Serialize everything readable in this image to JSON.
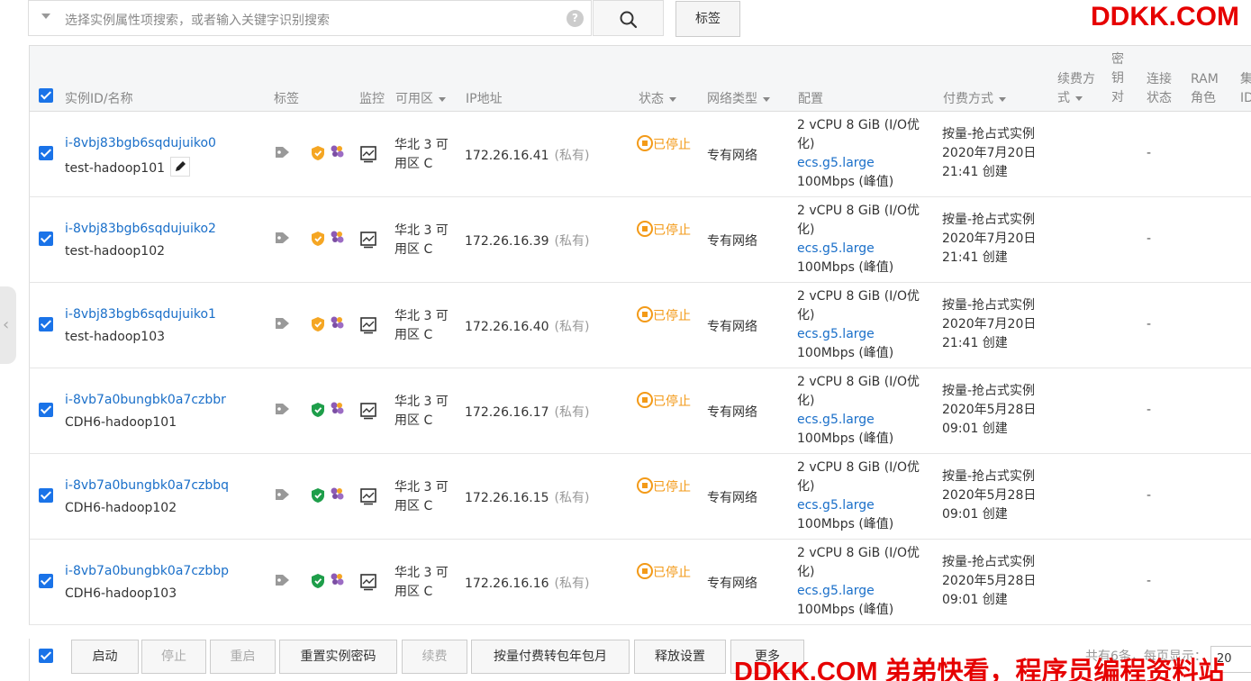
{
  "search": {
    "placeholder": "选择实例属性项搜索，或者输入关键字识别搜索",
    "help_icon": "?",
    "tag_button": "标签"
  },
  "watermark": {
    "top": "DDKK.COM",
    "bottom": "DDKK.COM 弟弟快看，程序员编程资料站"
  },
  "columns": {
    "id_name": "实例ID/名称",
    "tags": "标签",
    "monitor": "监控",
    "zone": "可用区",
    "ip": "IP地址",
    "status": "状态",
    "network": "网络类型",
    "config": "配置",
    "payment": "付费方式",
    "renew": "续费方式",
    "keypair": "密钥对",
    "conn": "连接状态",
    "ram": "RAM角色",
    "cluster": "集ID"
  },
  "rows": [
    {
      "id": "i-8vbj83bgb6sqdujuiko0",
      "name": "test-hadoop101",
      "shield_color": "#f5a623",
      "zone": "华北 3 可用区 C",
      "ip": "172.26.16.41",
      "ip_type": "(私有)",
      "status": "已停止",
      "network": "专有网络",
      "cfg1": "2 vCPU 8 GiB (I/O优化)",
      "cfg_type": "ecs.g5.large",
      "cfg_bw": "100Mbps (峰值)",
      "pay1": "按量-抢占式实例",
      "pay2": "2020年7月20日",
      "pay3": "21:41 创建",
      "conn": "-"
    },
    {
      "id": "i-8vbj83bgb6sqdujuiko2",
      "name": "test-hadoop102",
      "shield_color": "#f5a623",
      "zone": "华北 3 可用区 C",
      "ip": "172.26.16.39",
      "ip_type": "(私有)",
      "status": "已停止",
      "network": "专有网络",
      "cfg1": "2 vCPU 8 GiB (I/O优化)",
      "cfg_type": "ecs.g5.large",
      "cfg_bw": "100Mbps (峰值)",
      "pay1": "按量-抢占式实例",
      "pay2": "2020年7月20日",
      "pay3": "21:41 创建",
      "conn": "-"
    },
    {
      "id": "i-8vbj83bgb6sqdujuiko1",
      "name": "test-hadoop103",
      "shield_color": "#f5a623",
      "zone": "华北 3 可用区 C",
      "ip": "172.26.16.40",
      "ip_type": "(私有)",
      "status": "已停止",
      "network": "专有网络",
      "cfg1": "2 vCPU 8 GiB (I/O优化)",
      "cfg_type": "ecs.g5.large",
      "cfg_bw": "100Mbps (峰值)",
      "pay1": "按量-抢占式实例",
      "pay2": "2020年7月20日",
      "pay3": "21:41 创建",
      "conn": "-"
    },
    {
      "id": "i-8vb7a0bungbk0a7czbbr",
      "name": "CDH6-hadoop101",
      "shield_color": "#1e9e4a",
      "zone": "华北 3 可用区 C",
      "ip": "172.26.16.17",
      "ip_type": "(私有)",
      "status": "已停止",
      "network": "专有网络",
      "cfg1": "2 vCPU 8 GiB (I/O优化)",
      "cfg_type": "ecs.g5.large",
      "cfg_bw": "100Mbps (峰值)",
      "pay1": "按量-抢占式实例",
      "pay2": "2020年5月28日",
      "pay3": "09:01 创建",
      "conn": "-"
    },
    {
      "id": "i-8vb7a0bungbk0a7czbbq",
      "name": "CDH6-hadoop102",
      "shield_color": "#1e9e4a",
      "zone": "华北 3 可用区 C",
      "ip": "172.26.16.15",
      "ip_type": "(私有)",
      "status": "已停止",
      "network": "专有网络",
      "cfg1": "2 vCPU 8 GiB (I/O优化)",
      "cfg_type": "ecs.g5.large",
      "cfg_bw": "100Mbps (峰值)",
      "pay1": "按量-抢占式实例",
      "pay2": "2020年5月28日",
      "pay3": "09:01 创建",
      "conn": "-"
    },
    {
      "id": "i-8vb7a0bungbk0a7czbbp",
      "name": "CDH6-hadoop103",
      "shield_color": "#1e9e4a",
      "zone": "华北 3 可用区 C",
      "ip": "172.26.16.16",
      "ip_type": "(私有)",
      "status": "已停止",
      "network": "专有网络",
      "cfg1": "2 vCPU 8 GiB (I/O优化)",
      "cfg_type": "ecs.g5.large",
      "cfg_bw": "100Mbps (峰值)",
      "pay1": "按量-抢占式实例",
      "pay2": "2020年5月28日",
      "pay3": "09:01 创建",
      "conn": "-"
    }
  ],
  "footer": {
    "start": "启动",
    "stop": "停止",
    "restart": "重启",
    "reset_pwd": "重置实例密码",
    "renew": "续费",
    "convert": "按量付费转包年包月",
    "release": "释放设置",
    "more": "更多",
    "pager": "共有6条，每页显示：",
    "page_size": "20"
  },
  "colors": {
    "accent": "#1a73e8",
    "link": "#1a6fc9",
    "stopped": "#f39a18",
    "watermark": "#e60000"
  }
}
